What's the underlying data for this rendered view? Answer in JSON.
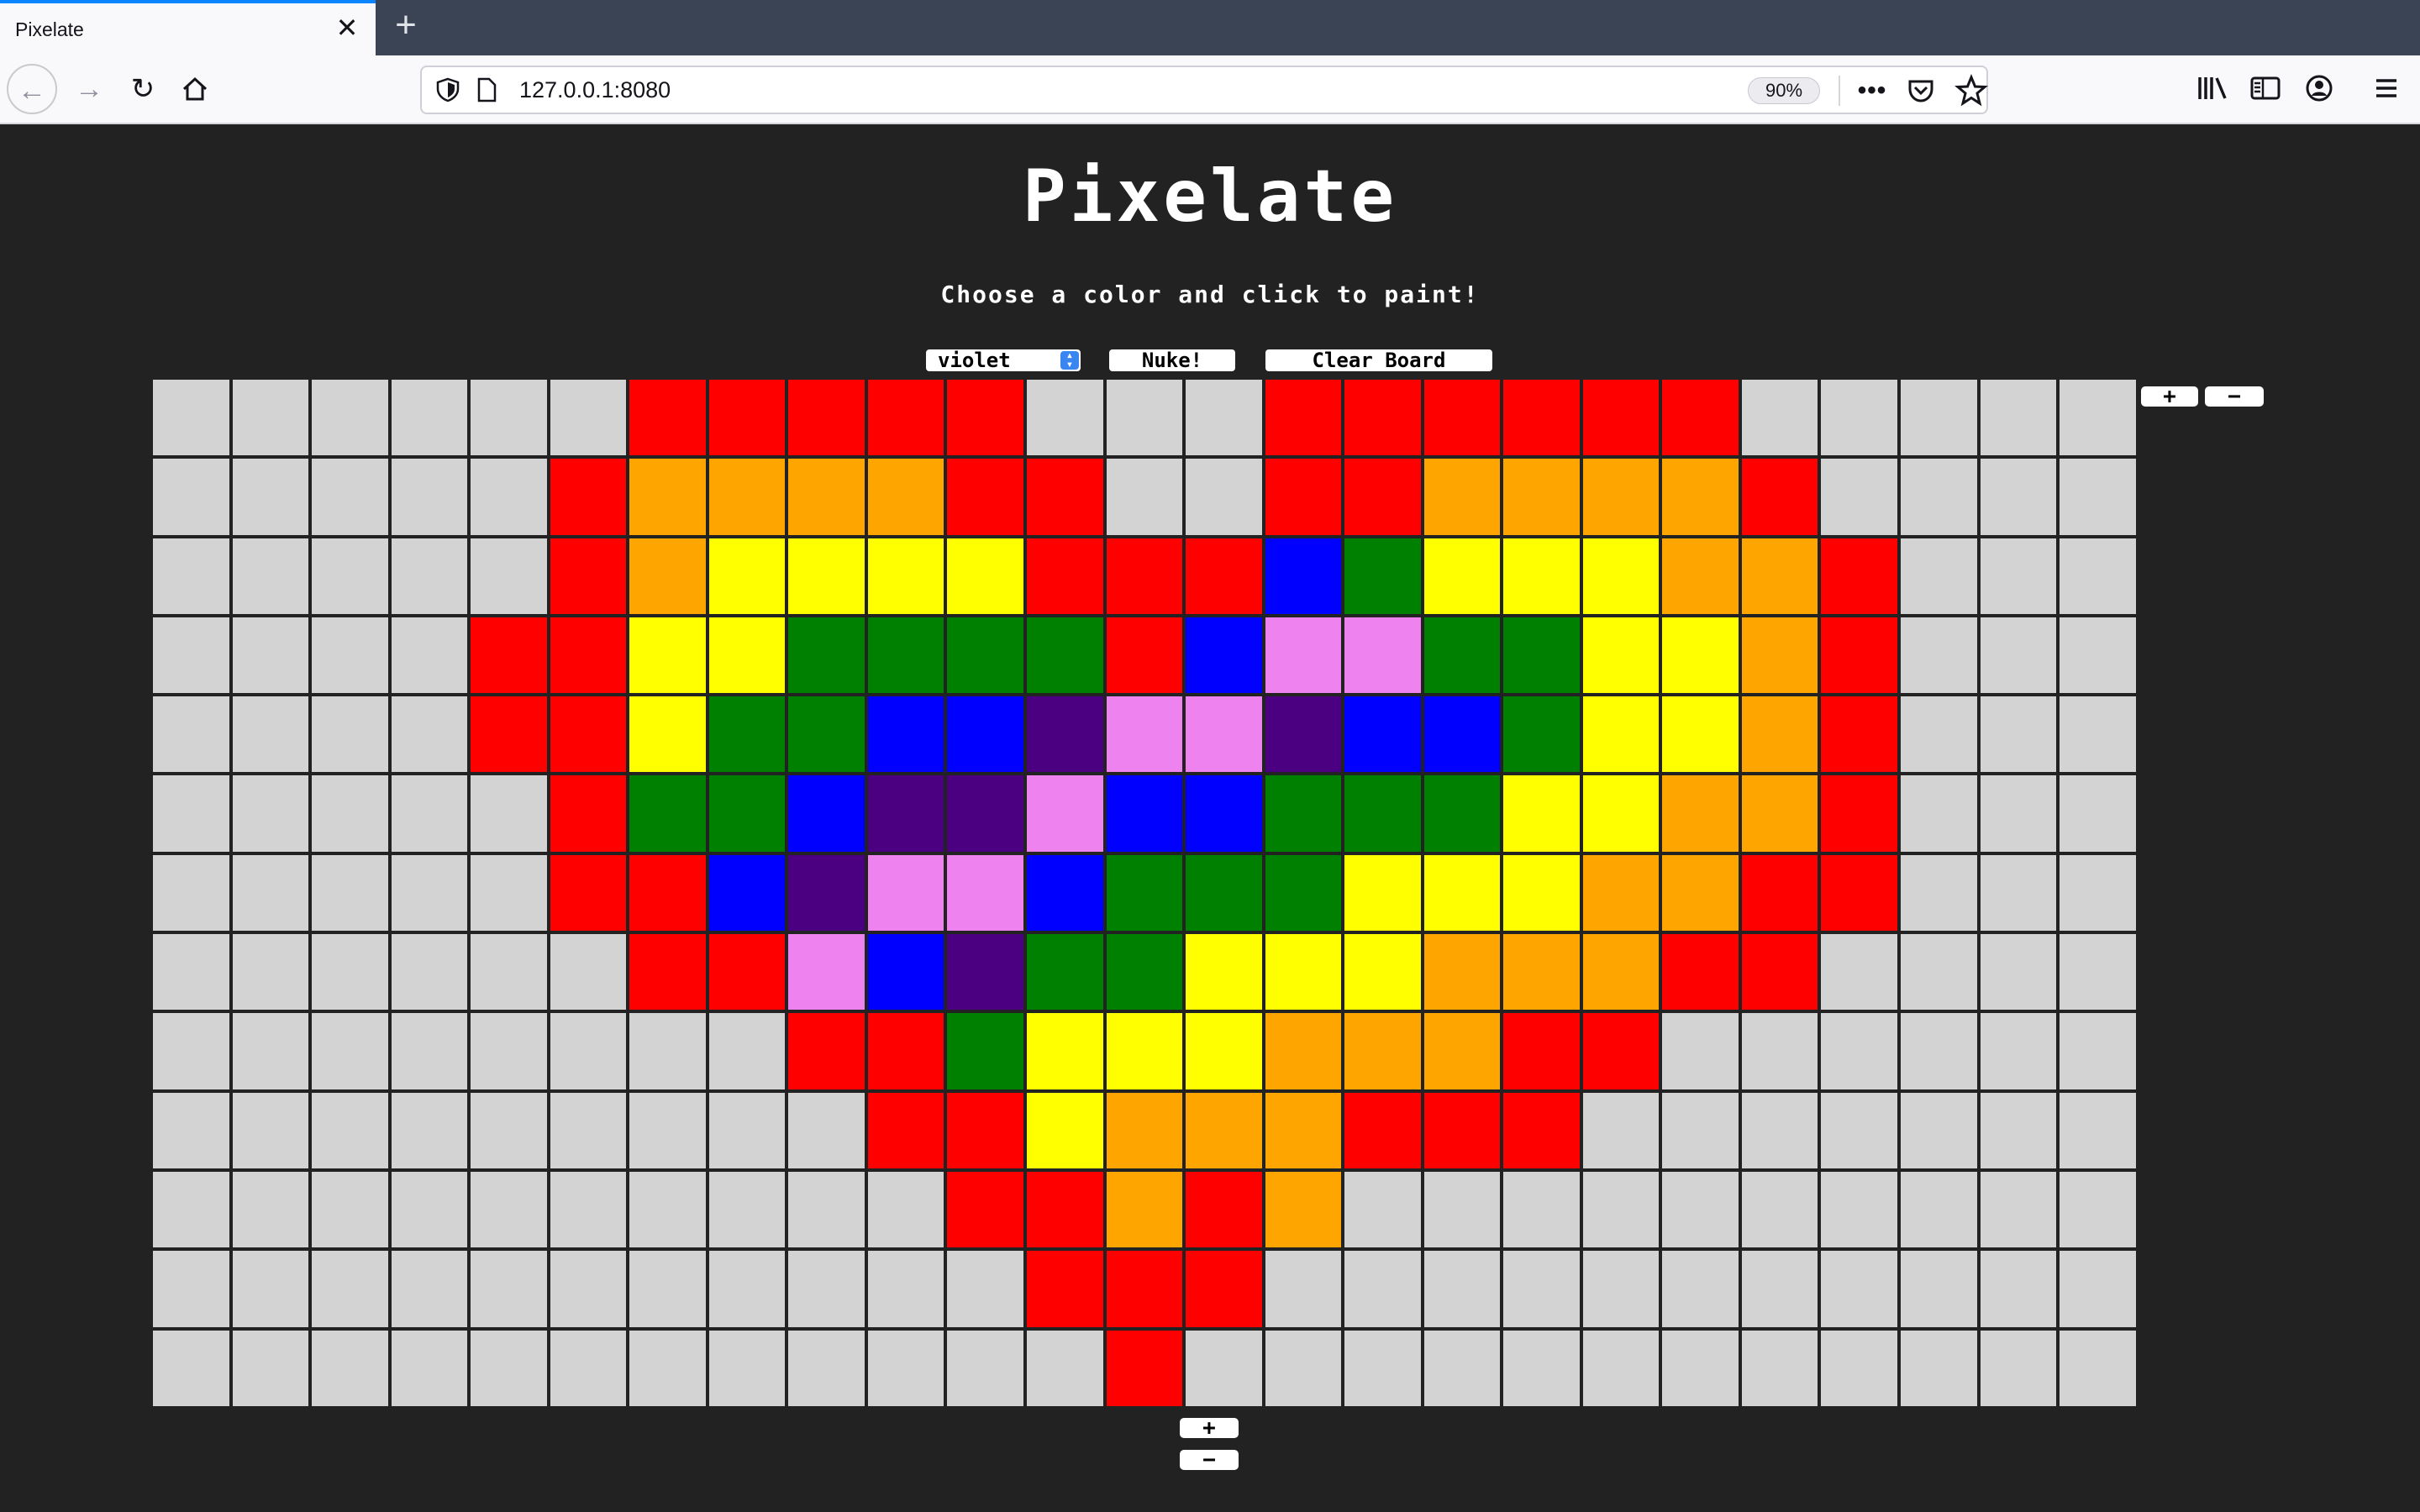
{
  "browser": {
    "tab_title": "Pixelate",
    "tab_close": "✕",
    "new_tab": "+",
    "url": "127.0.0.1:8080",
    "zoom": "90%",
    "more": "•••"
  },
  "app": {
    "title": "Pixelate",
    "subtitle": "Choose a color and click to paint!",
    "color_select": "violet",
    "nuke_label": "Nuke!",
    "clear_label": "Clear Board",
    "add_col_label": "+",
    "remove_col_label": "−",
    "add_row_label": "+",
    "remove_row_label": "−"
  },
  "colors": {
    "X": "#d3d3d3",
    "R": "#ff0000",
    "O": "#ffa500",
    "Y": "#ffff00",
    "G": "#008000",
    "B": "#0000ff",
    "I": "#4b0082",
    "V": "#ee82ee"
  },
  "board": {
    "rows": 13,
    "cols": 25,
    "cells": [
      "XXXXXXRRRRRXXXRRRRRRXXXXX",
      "XXXXXROOOORRXXRROOOORXXXX",
      "XXXXXROYYYYRRRBGYYYOORXXX",
      "XXXXRRYYGGGGRBVVGGYYORXXX",
      "XXXXRRYGGBBIVVIBBGYYORXXX",
      "XXXXXRGGBIIVBBGGGYYOORXXX",
      "XXXXXRRBIVVBGGGYYYOORRXXX",
      "XXXXXXRRVBIGGYYYOOORRXXXX",
      "XXXXXXXXRRGYYYOOORRXXXXXX",
      "XXXXXXXXXRRYOOORRRXXXXXXX",
      "XXXXXXXXXXRROROXXXXXXXXXX",
      "XXXXXXXXXXXRRRXXXXXXXXXXX",
      "XXXXXXXXXXXXRXXXXXXXXXXXX"
    ]
  }
}
